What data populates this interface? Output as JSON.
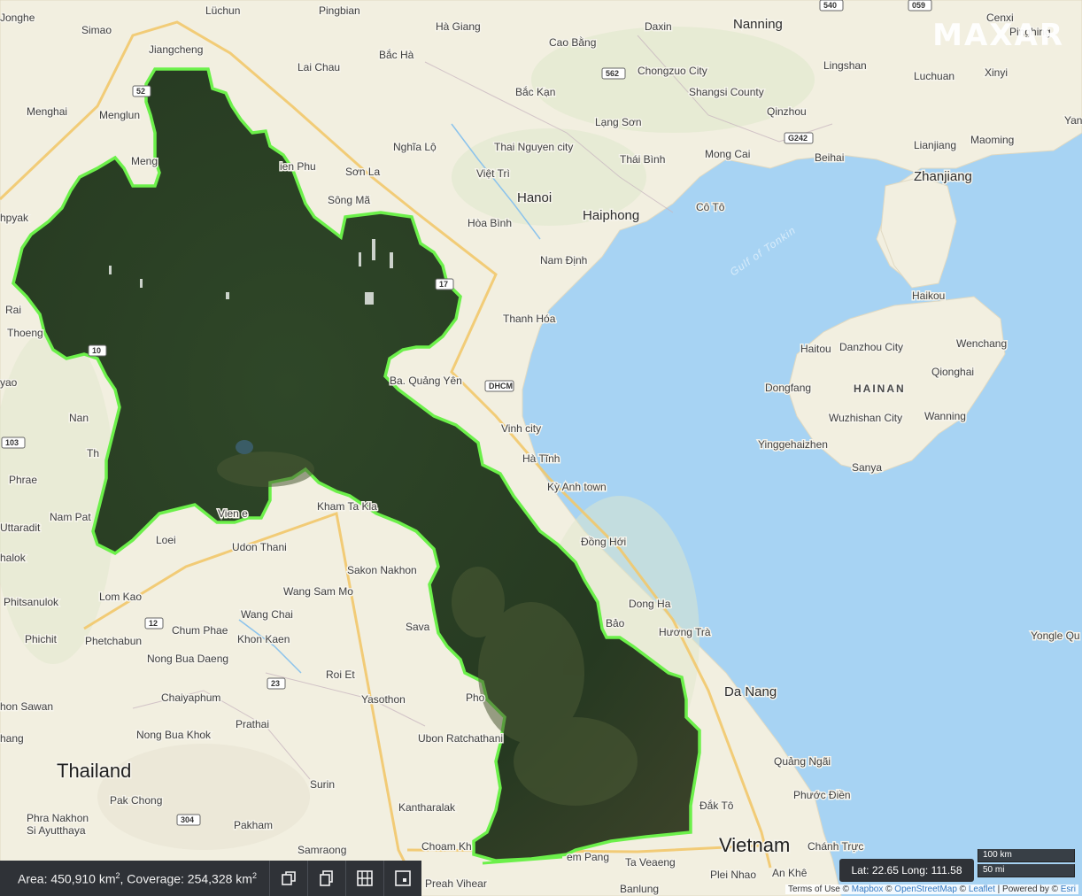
{
  "watermark": "MAXAR",
  "map": {
    "countries": [
      "Thailand",
      "Vietnam"
    ],
    "water": "Gulf of Tonkin",
    "region": "HAINAN",
    "big_cities": [
      "Hanoi",
      "Nanning",
      "Da Nang",
      "Haiphong",
      "Zhanjiang"
    ],
    "cities": [
      "Jonghe",
      "Lüchun",
      "Pingbian",
      "Simao",
      "Jiangcheng",
      "Hà Giang",
      "Daxin",
      "Cenxi",
      "Lai Chau",
      "Bắc Hà",
      "Cao Bằng",
      "Chongzuo City",
      "Lingshan",
      "Luchuan",
      "Xinyi",
      "Menghai",
      "Menglun",
      "Bắc Kạn",
      "Shangsi County",
      "Qinzhou",
      "Lạng Sơn",
      "Lianjiang",
      "Maoming",
      "Meng",
      "Nghĩa Lộ",
      "Thai Nguyen city",
      "Thái Bình",
      "Mong Cai",
      "Beihai",
      "ien Phu",
      "Sơn La",
      "Việt Trì",
      "Sông Mã",
      "Hòa Bình",
      "Cô Tô",
      "Nam Định",
      "Haikou",
      "Thanh Hóa",
      "Haitou",
      "Danzhou City",
      "Wenchang",
      "Qionghai",
      "Dongfang",
      "Wuzhishan City",
      "Wanning",
      "Yinggehaizhen",
      "Sanya",
      "Ba. Quảng Yên",
      "Vinh city",
      "Hà Tĩnh",
      "Kỳ Anh town",
      "Đồng Hới",
      "Dong Ha",
      "Hương Trà",
      "Bảo",
      "Quảng Ngãi",
      "Phước Điền",
      "Đắk Tô",
      "Chánh Trực",
      "An Khê",
      "Plei Nhao",
      "Banlung",
      "Ta Veaeng",
      "Preah Vihear",
      "Choam Kh",
      "em Pang",
      "Samraong",
      "Kantharalak",
      "Surin",
      "Ubon Ratchathani",
      "Pho",
      "Yasothon",
      "Roi Et",
      "Prathai",
      "Sava",
      "Khon Kaen",
      "Wang Chai",
      "Wang Sam Mo",
      "Sakon Nakhon",
      "Kham Ta Kla",
      "Udon Thani",
      "Vien e",
      "Loei",
      "Lom Kao",
      "Nam Pat",
      "Phrae",
      "Nan",
      "Th",
      "Thoeng",
      "yao",
      "Rai",
      "hpyak",
      "Uttaradit",
      "halok",
      "Phitsanulok",
      "Phichit",
      "Phetchabun",
      "Chum Phae",
      "Nong Bua Daeng",
      "Chaiyaphum",
      "Nong Bua Khok",
      "hon Sawan",
      "hang",
      "Pak Chong",
      "Phra Nakhon Si Ayutthaya",
      "Pakham",
      "Yongle Qu",
      "Pinghing",
      "Yan"
    ],
    "road_shields": [
      "562",
      "G242",
      "DHCM",
      "17",
      "52",
      "103",
      "12",
      "23",
      "304",
      "540",
      "059",
      "10"
    ]
  },
  "toolbar": {
    "area_label": "Area: 450,910 km",
    "coverage_label": ", Coverage: 254,328 km",
    "sq": "2",
    "buttons": [
      "copy-icon",
      "duplicate-icon",
      "grid-icon",
      "export-icon"
    ]
  },
  "coords": "Lat: 22.65 Long: 111.58",
  "scale": {
    "km": "100 km",
    "mi": "50 mi"
  },
  "attribution": {
    "prefix": "Terms of Use © ",
    "mapbox": "Mapbox",
    "osm": "OpenStreetMap",
    "leaflet": "Leaflet",
    "powered": "Powered by © ",
    "esri": "Esri"
  },
  "colors": {
    "sea": "#a7d3f3",
    "land": "#f2efe0",
    "imagery": "#283b22",
    "aoi_outline": "#6cf04a",
    "border": "#f2c86b"
  }
}
